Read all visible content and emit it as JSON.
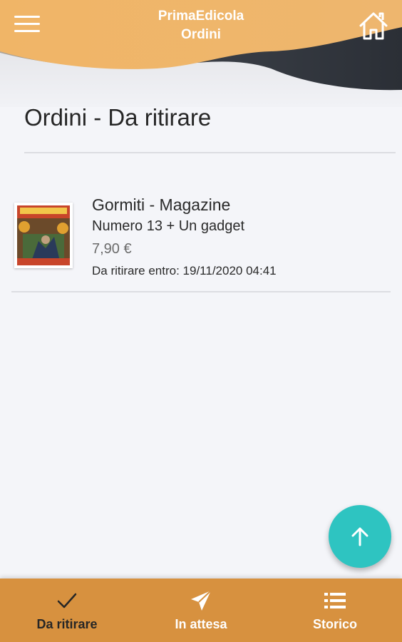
{
  "header": {
    "app_name": "PrimaEdicola",
    "section": "Ordini",
    "menu_icon": "hamburger-menu-icon",
    "home_icon": "home-icon"
  },
  "page": {
    "title": "Ordini - Da ritirare"
  },
  "orders": [
    {
      "name": "Gormiti - Magazine",
      "subtitle": "Numero 13 + Un gadget",
      "price": "7,90 €",
      "deadline": "Da ritirare entro: 19/11/2020 04:41",
      "thumbnail": "magazine-cover-image"
    }
  ],
  "fab": {
    "icon": "arrow-up-icon"
  },
  "bottom_nav": [
    {
      "label": "Da ritirare",
      "icon": "check-icon",
      "active": true
    },
    {
      "label": "In attesa",
      "icon": "send-icon",
      "active": false
    },
    {
      "label": "Storico",
      "icon": "list-icon",
      "active": false
    }
  ],
  "colors": {
    "header_orange": "#efb568",
    "header_dark": "#2f3640",
    "accent_teal": "#2ec4c1",
    "nav_orange": "#d7913f",
    "background": "#f4f5f9"
  }
}
